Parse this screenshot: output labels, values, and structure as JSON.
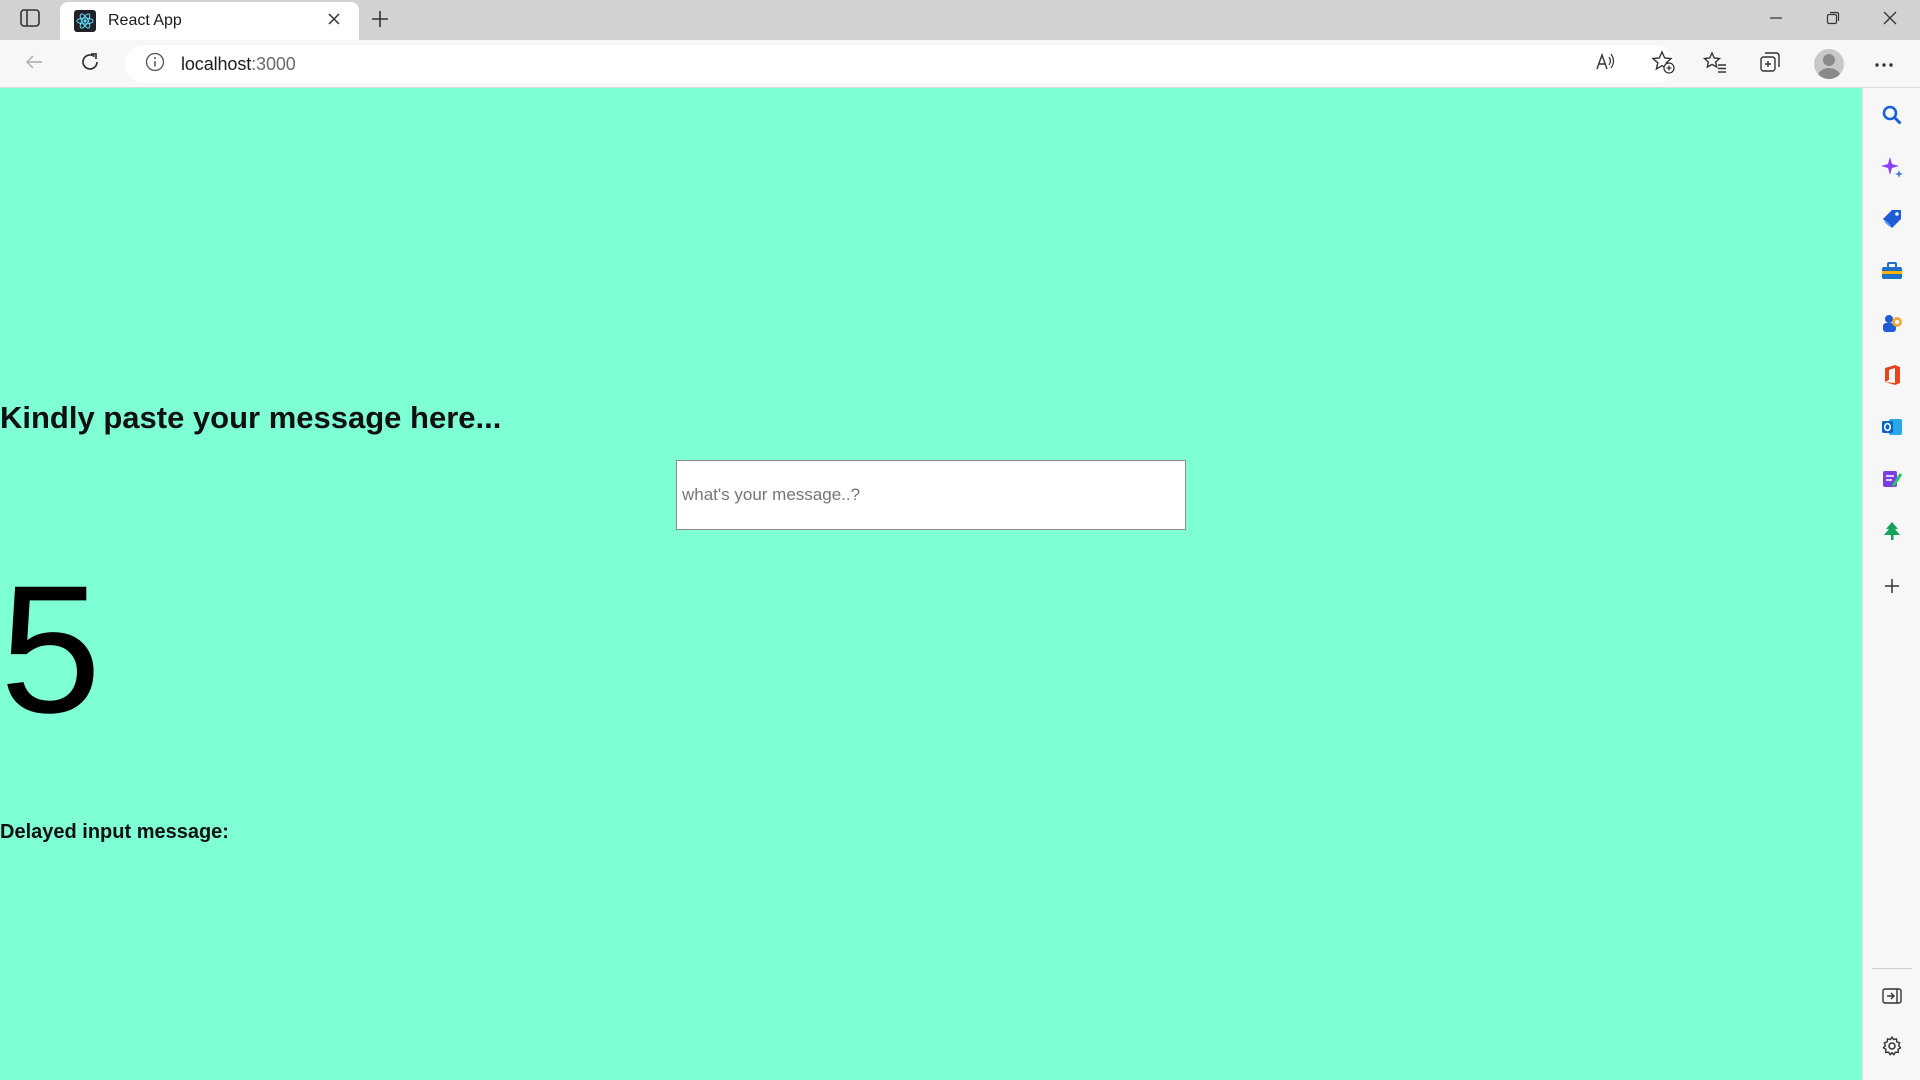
{
  "browser": {
    "tab": {
      "title": "React App",
      "favicon": "react-logo-icon"
    },
    "address": {
      "host": "localhost",
      "port": ":3000"
    },
    "icons": {
      "tab_actions": "tab-actions-icon",
      "new_tab": "plus-icon",
      "back": "back-arrow-icon",
      "refresh": "refresh-icon",
      "site_info": "info-icon",
      "read_aloud": "read-aloud-icon",
      "add_favorite": "star-add-icon",
      "favorites": "favorites-icon",
      "collections": "collections-icon",
      "profile": "profile-avatar-icon",
      "more": "more-icon"
    },
    "sidebar_icons": [
      "search-icon",
      "copilot-icon",
      "shopping-icon",
      "tools-icon",
      "games-icon",
      "office-icon",
      "outlook-icon",
      "designer-icon",
      "tree-icon",
      "add-icon",
      "hide-sidebar-icon",
      "settings-icon"
    ]
  },
  "page": {
    "background": "#7fffd4",
    "heading": "Kindly paste your message here...",
    "input": {
      "value": "",
      "placeholder": "what's your message..?"
    },
    "counter": "5",
    "delayed_label": "Delayed input message:"
  }
}
